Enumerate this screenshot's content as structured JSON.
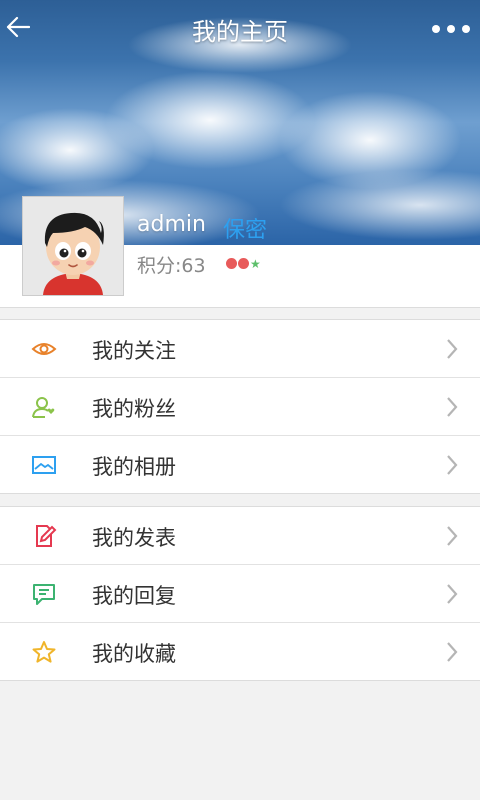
{
  "topbar": {
    "back_icon": "arrow-left-icon",
    "title": "我的主页",
    "more_icon": "more-dots-icon"
  },
  "profile": {
    "avatar": "avatar-cartoon-boy",
    "username": "admin",
    "privacy": "保密",
    "score": "积分:63",
    "level": {
      "dots": 2,
      "stars": 1,
      "dot_color": "#e85a5a",
      "star_color": "#5dbf6b"
    }
  },
  "groups": [
    {
      "items": [
        {
          "label": "我的关注",
          "icon": "eye-icon",
          "color": "#e8822b"
        },
        {
          "label": "我的粉丝",
          "icon": "user-heart-icon",
          "color": "#8bc34a"
        },
        {
          "label": "我的相册",
          "icon": "image-icon",
          "color": "#2da0f0"
        }
      ]
    },
    {
      "items": [
        {
          "label": "我的发表",
          "icon": "edit-note-icon",
          "color": "#e53950"
        },
        {
          "label": "我的回复",
          "icon": "comment-icon",
          "color": "#3cb371"
        },
        {
          "label": "我的收藏",
          "icon": "star-outline-icon",
          "color": "#f0b52b"
        }
      ]
    }
  ],
  "colors": {
    "accent": "#2da0f0",
    "background": "#f2f2f2"
  }
}
